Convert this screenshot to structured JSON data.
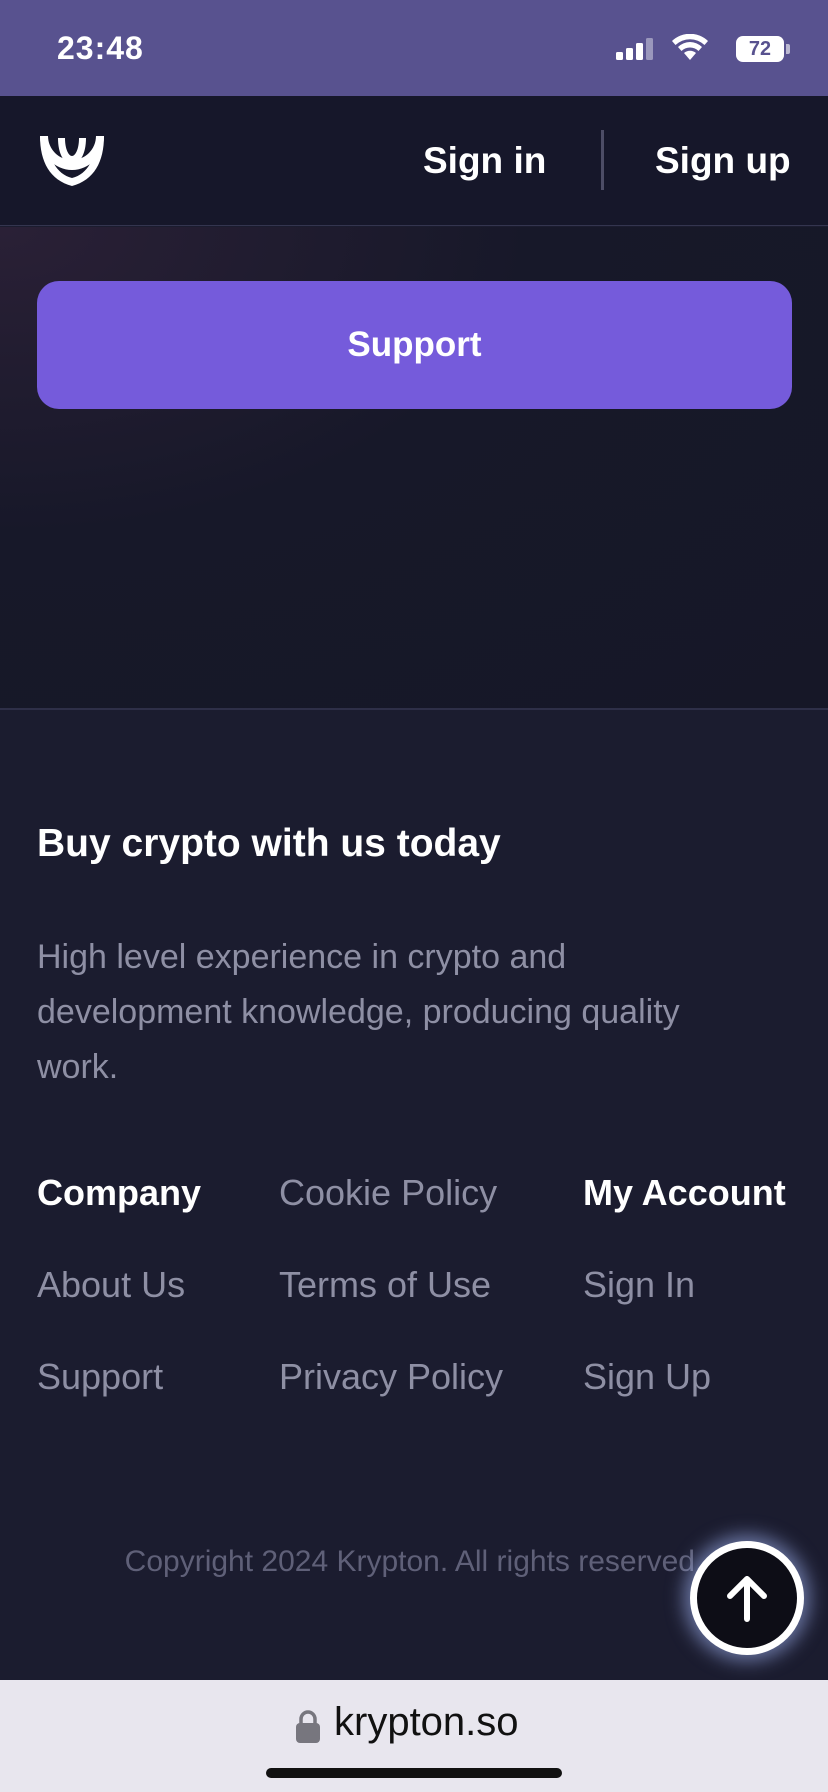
{
  "status": {
    "time": "23:48",
    "battery": "72"
  },
  "nav": {
    "signin": "Sign in",
    "signup": "Sign up"
  },
  "hero": {
    "support_label": "Support"
  },
  "footer": {
    "title": "Buy crypto with us today",
    "description": "High level experience in crypto and development knowledge, producing quality work.",
    "columns": [
      {
        "items": [
          "Company",
          "About Us",
          "Support"
        ]
      },
      {
        "items": [
          "Cookie Policy",
          "Terms of Use",
          "Privacy Policy"
        ]
      },
      {
        "items": [
          "My Account",
          "Sign In",
          "Sign Up"
        ]
      }
    ],
    "copyright": "Copyright 2024 Krypton. All rights reserved."
  },
  "browser": {
    "url": "krypton.so"
  },
  "icons": {
    "logo": "krypton-logo-icon",
    "scroll_top": "arrow-up-icon",
    "lock": "lock-icon"
  },
  "colors": {
    "accent": "#755bdb",
    "status_bar": "#58528f",
    "background": "#1b1c2f",
    "muted_text": "#8e8fa4"
  }
}
